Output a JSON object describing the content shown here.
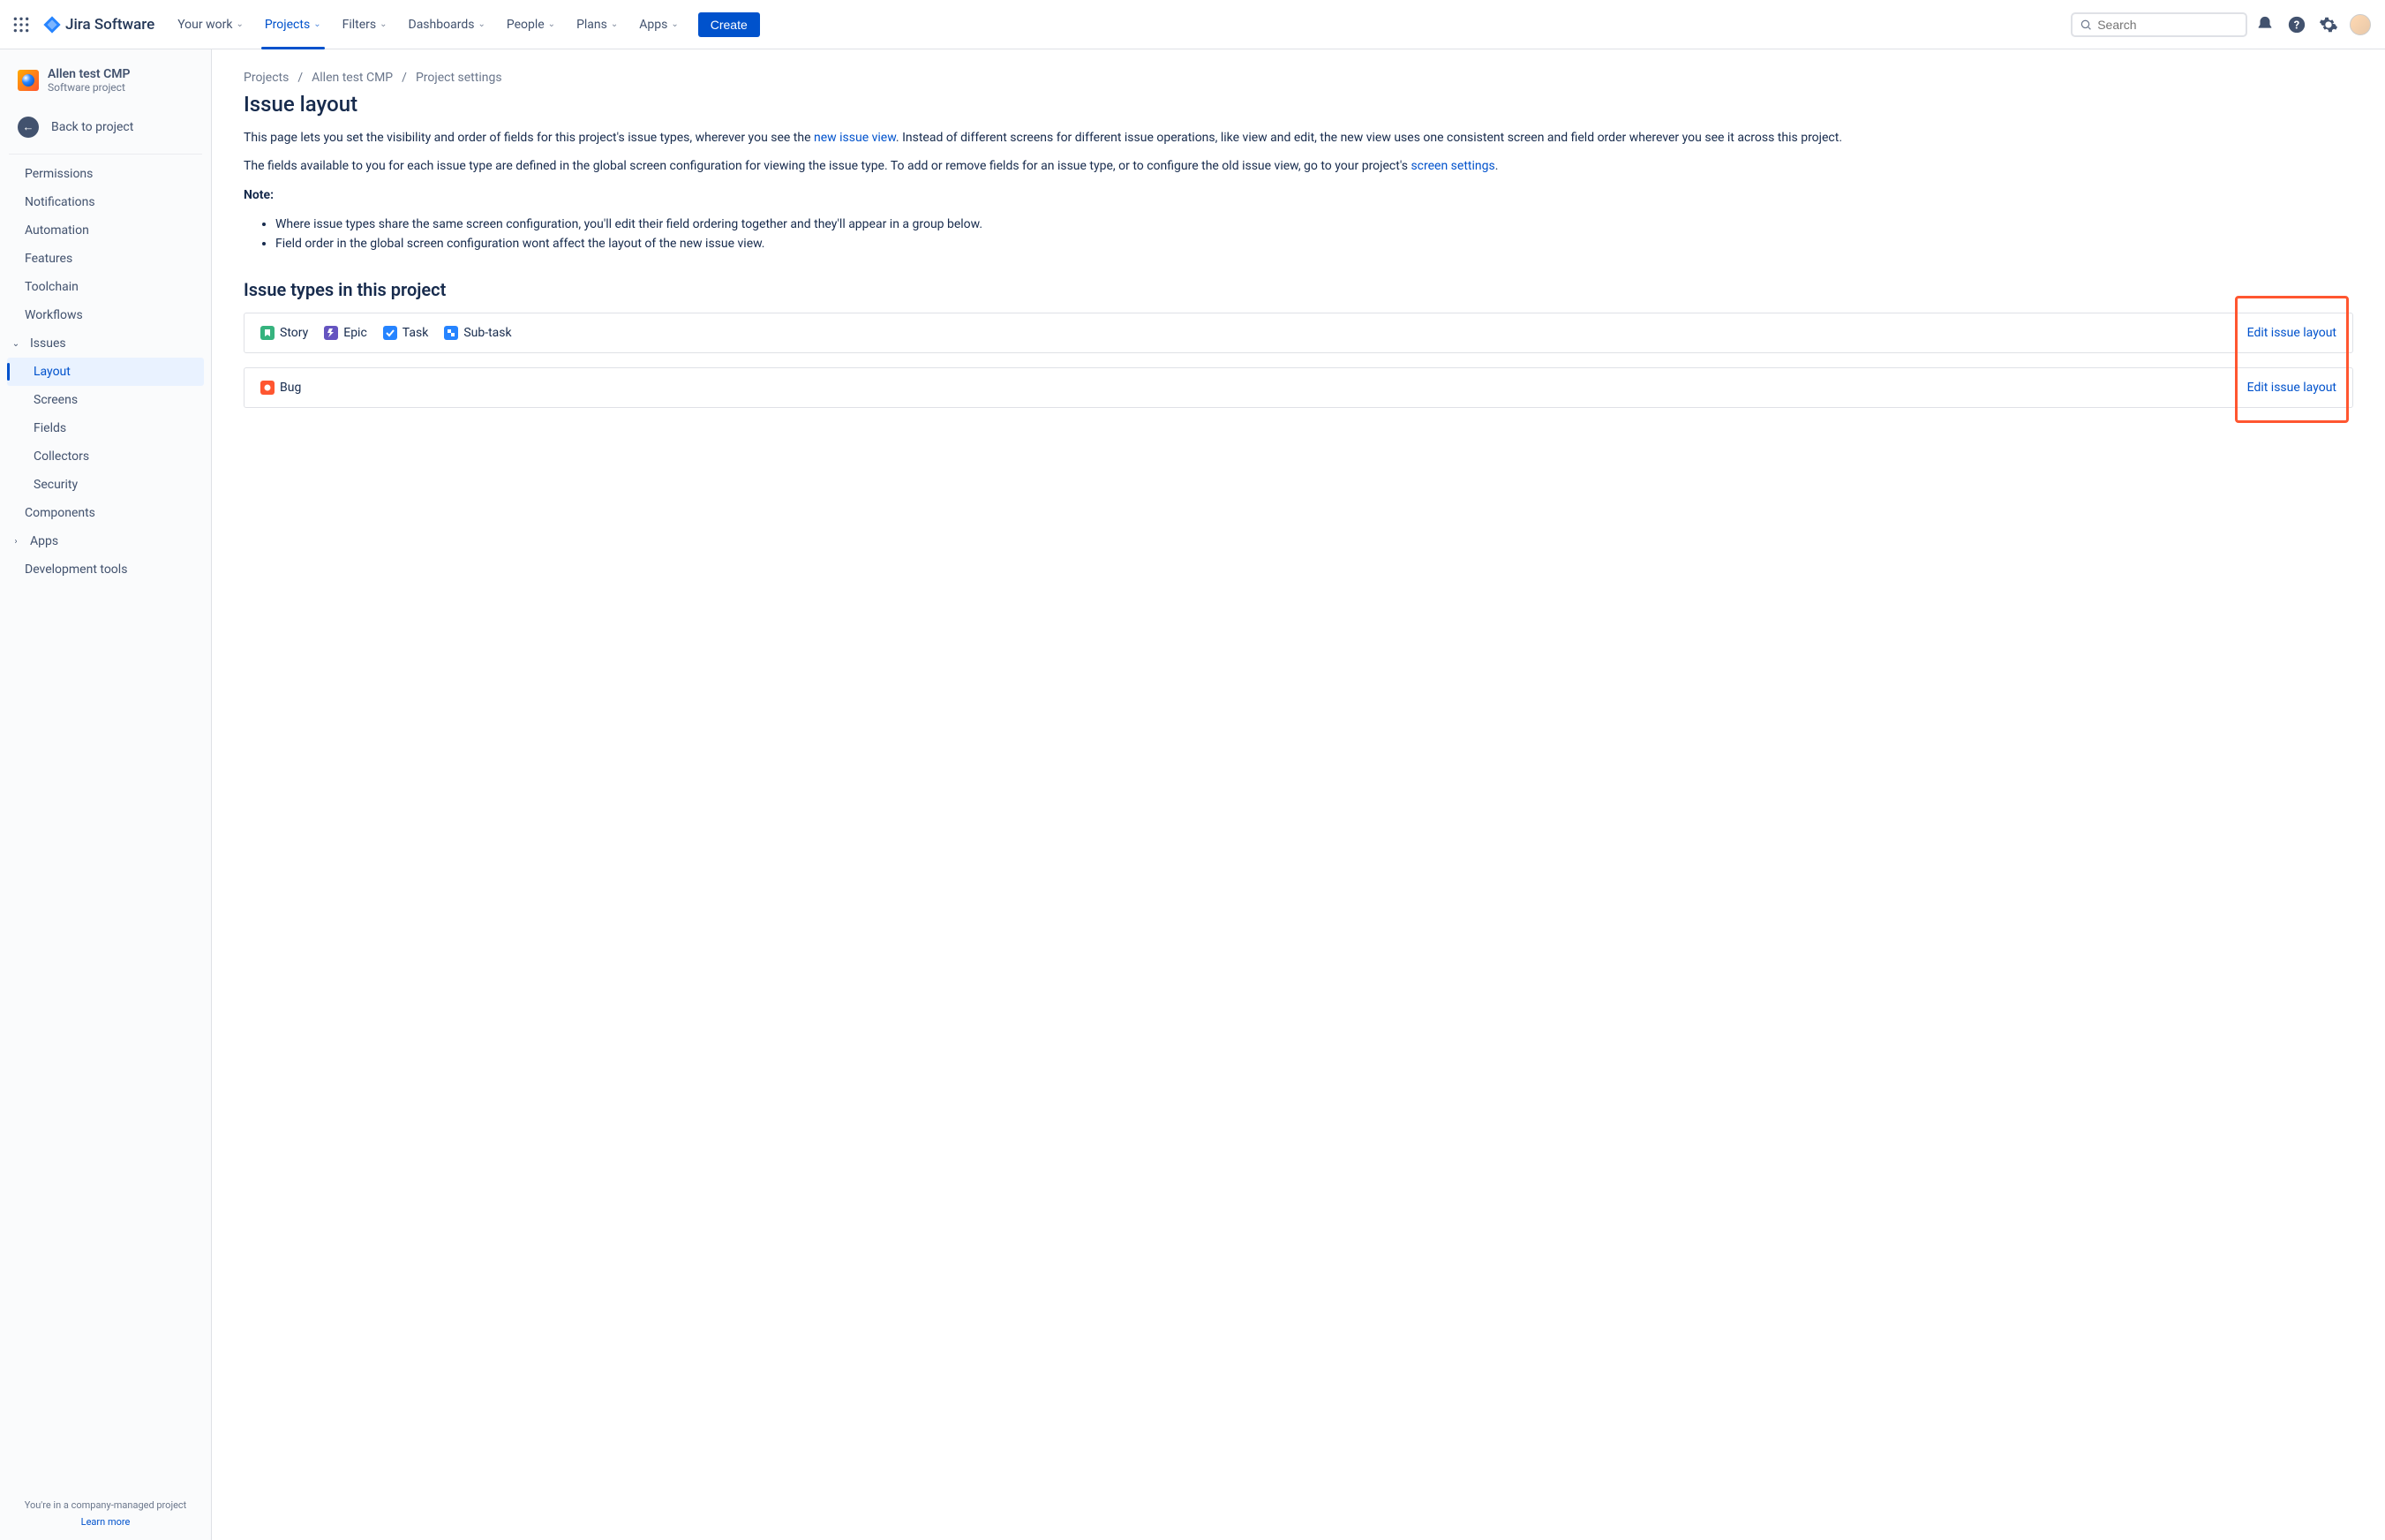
{
  "topnav": {
    "logo_text": "Jira Software",
    "items": [
      "Your work",
      "Projects",
      "Filters",
      "Dashboards",
      "People",
      "Plans",
      "Apps"
    ],
    "active_index": 1,
    "create": "Create",
    "search_placeholder": "Search"
  },
  "sidebar": {
    "project_name": "Allen test CMP",
    "project_type": "Software project",
    "back": "Back to project",
    "items_top": [
      "Permissions",
      "Notifications",
      "Automation",
      "Features",
      "Toolchain",
      "Workflows"
    ],
    "group_issues": "Issues",
    "issues_sub": [
      "Layout",
      "Screens",
      "Fields",
      "Collectors",
      "Security"
    ],
    "issues_active_index": 0,
    "items_bottom": [
      "Components"
    ],
    "group_apps": "Apps",
    "items_after": [
      "Development tools"
    ],
    "footer_text": "You're in a company-managed project",
    "footer_link": "Learn more"
  },
  "breadcrumb": [
    "Projects",
    "Allen test CMP",
    "Project settings"
  ],
  "page": {
    "title": "Issue layout",
    "p1_a": "This page lets you set the visibility and order of fields for this project's issue types, wherever you see the ",
    "p1_link": "new issue view",
    "p1_b": ". Instead of different screens for different issue operations, like view and edit, the new view uses one consistent screen and field order wherever you see it across this project.",
    "p2_a": "The fields available to you for each issue type are defined in the global screen configuration for viewing the issue type. To add or remove fields for an issue type, or to configure the old issue view, go to your project's ",
    "p2_link": "screen settings",
    "p2_b": ".",
    "note_label": "Note:",
    "note_items": [
      "Where issue types share the same screen configuration, you'll edit their field ordering together and they'll appear in a group below.",
      "Field order in the global screen configuration wont affect the layout of the new issue view."
    ],
    "section_title": "Issue types in this project",
    "groups": [
      {
        "types": [
          {
            "name": "Story",
            "icon": "story"
          },
          {
            "name": "Epic",
            "icon": "epic"
          },
          {
            "name": "Task",
            "icon": "task"
          },
          {
            "name": "Sub-task",
            "icon": "subtask"
          }
        ],
        "action": "Edit issue layout"
      },
      {
        "types": [
          {
            "name": "Bug",
            "icon": "bug"
          }
        ],
        "action": "Edit issue layout"
      }
    ]
  }
}
